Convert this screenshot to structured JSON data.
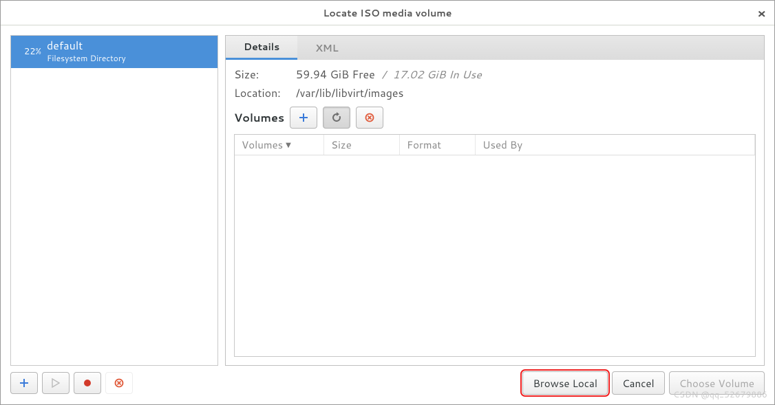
{
  "window": {
    "title": "Locate ISO media volume"
  },
  "sidebar": {
    "pools": [
      {
        "percent": "22%",
        "name": "default",
        "type": "Filesystem Directory"
      }
    ]
  },
  "tabs": {
    "details": "Details",
    "xml": "XML"
  },
  "details": {
    "size_label": "Size:",
    "size_free": "59.94 GiB Free",
    "size_sep": "/",
    "size_inuse": "17.02 GiB In Use",
    "location_label": "Location:",
    "location_value": "/var/lib/libvirt/images",
    "volumes_label": "Volumes"
  },
  "vol_table": {
    "col_volumes": "Volumes",
    "col_size": "Size",
    "col_format": "Format",
    "col_usedby": "Used By"
  },
  "footer": {
    "browse_local": "Browse Local",
    "cancel": "Cancel",
    "choose_volume": "Choose Volume"
  },
  "watermark": "CSDN @qq_52679886"
}
